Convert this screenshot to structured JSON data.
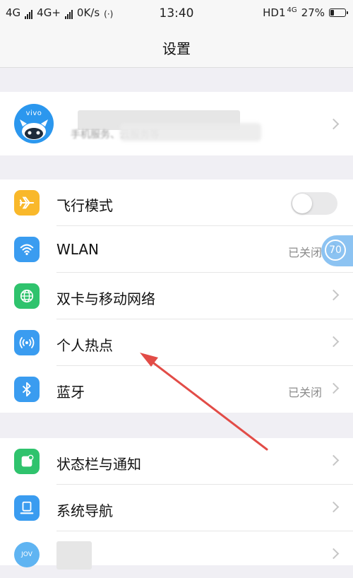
{
  "status_bar": {
    "signal1": "4G",
    "signal2": "4G+",
    "speed": "0K/s",
    "time": "13:40",
    "hd": "HD1",
    "net": "4G",
    "battery_text": "27%",
    "battery_level": 0.27
  },
  "header": {
    "title": "设置"
  },
  "account": {
    "brand": "vivo",
    "subtext": "手机服务、云服务等"
  },
  "group1": [
    {
      "label": "飞行模式",
      "icon": "airplane-icon",
      "color": "#f9b82a",
      "control": "toggle",
      "on": false
    },
    {
      "label": "WLAN",
      "icon": "wifi-icon",
      "color": "#3a9cf0",
      "status": "已关闭"
    },
    {
      "label": "双卡与移动网络",
      "icon": "globe-icon",
      "color": "#2fc36d"
    },
    {
      "label": "个人热点",
      "icon": "hotspot-icon",
      "color": "#3a9cf0"
    },
    {
      "label": "蓝牙",
      "icon": "bluetooth-icon",
      "color": "#3a9cf0",
      "status": "已关闭"
    }
  ],
  "group2": [
    {
      "label": "状态栏与通知",
      "icon": "notification-icon",
      "color": "#2fc36d"
    },
    {
      "label": "系统导航",
      "icon": "navigation-icon",
      "color": "#3a9cf0"
    },
    {
      "label": "",
      "icon": "jovi-icon",
      "color": "#3a9cf0"
    }
  ],
  "floating_ball": {
    "value": "70"
  },
  "colors": {
    "accent_arrow": "#e24c47",
    "background": "#f0eff4"
  }
}
